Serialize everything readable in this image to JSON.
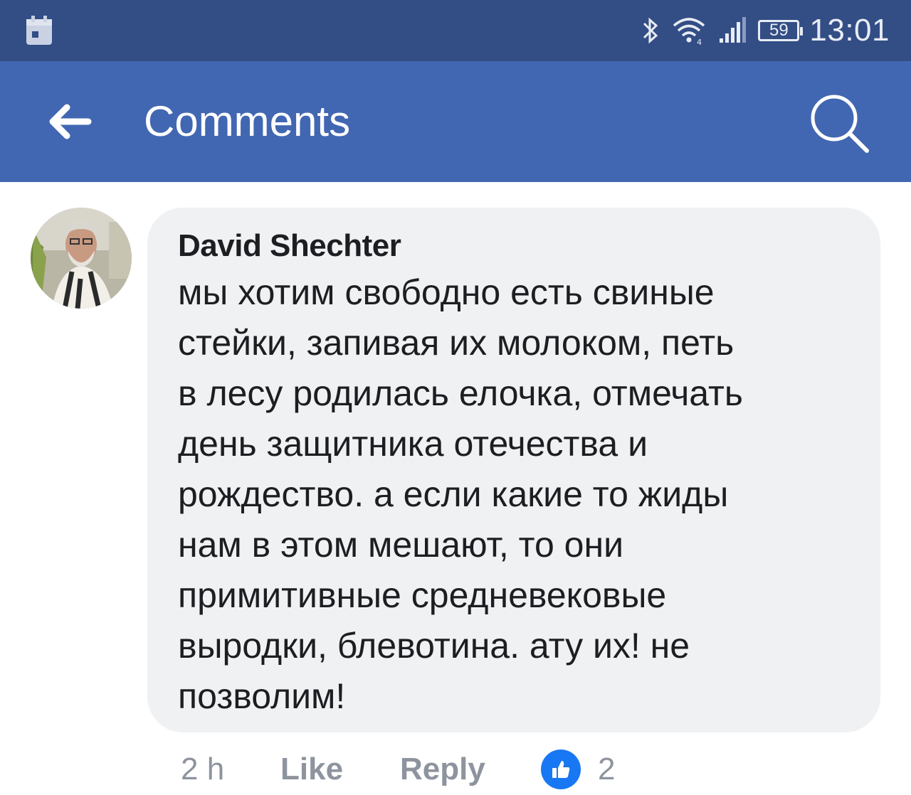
{
  "status_bar": {
    "time": "13:01",
    "battery": "59",
    "icons": [
      "calendar-icon",
      "bluetooth-icon",
      "wifi-icon",
      "signal-icon",
      "battery-icon"
    ]
  },
  "app_bar": {
    "title": "Comments",
    "back_icon": "arrow-left-icon",
    "search_icon": "search-icon",
    "background": "#4267b2"
  },
  "comment": {
    "author": "David Shechter",
    "lines": [
      "мы хотим свободно есть свиные",
      "стейки, запивая их молоком, петь",
      "в лесу родилась елочка, отмечать",
      "день защитника отечества и",
      "рождество. а если какие то жиды",
      "нам в этом мешают, то они",
      "примитивные средневековые",
      "выродки, блевотина. ату их! не",
      "позволим!"
    ],
    "time": "2 h",
    "like_label": "Like",
    "reply_label": "Reply",
    "reaction_icon": "thumbs-up-icon",
    "reaction_count": "2"
  }
}
